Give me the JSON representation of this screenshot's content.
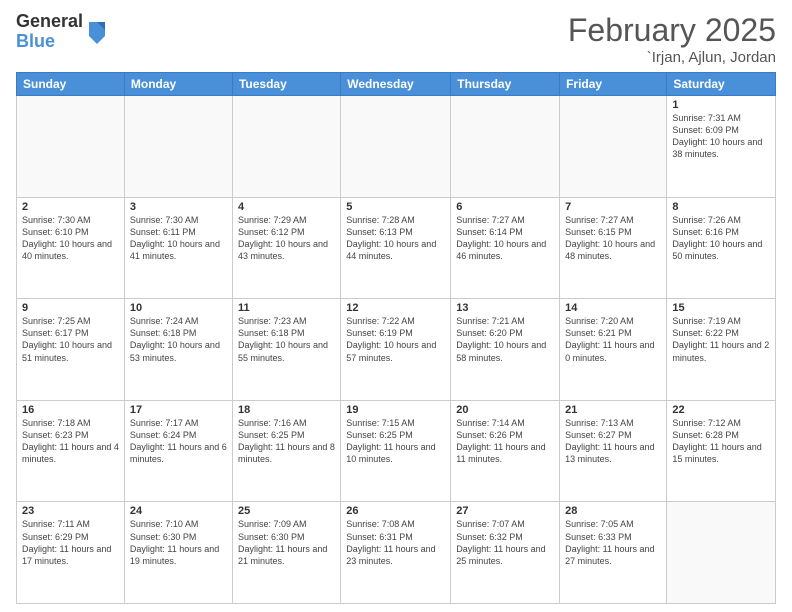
{
  "header": {
    "logo_general": "General",
    "logo_blue": "Blue",
    "month_title": "February 2025",
    "location": "`Irjan, Ajlun, Jordan"
  },
  "weekdays": [
    "Sunday",
    "Monday",
    "Tuesday",
    "Wednesday",
    "Thursday",
    "Friday",
    "Saturday"
  ],
  "weeks": [
    [
      {
        "day": "",
        "info": ""
      },
      {
        "day": "",
        "info": ""
      },
      {
        "day": "",
        "info": ""
      },
      {
        "day": "",
        "info": ""
      },
      {
        "day": "",
        "info": ""
      },
      {
        "day": "",
        "info": ""
      },
      {
        "day": "1",
        "info": "Sunrise: 7:31 AM\nSunset: 6:09 PM\nDaylight: 10 hours\nand 38 minutes."
      }
    ],
    [
      {
        "day": "2",
        "info": "Sunrise: 7:30 AM\nSunset: 6:10 PM\nDaylight: 10 hours\nand 40 minutes."
      },
      {
        "day": "3",
        "info": "Sunrise: 7:30 AM\nSunset: 6:11 PM\nDaylight: 10 hours\nand 41 minutes."
      },
      {
        "day": "4",
        "info": "Sunrise: 7:29 AM\nSunset: 6:12 PM\nDaylight: 10 hours\nand 43 minutes."
      },
      {
        "day": "5",
        "info": "Sunrise: 7:28 AM\nSunset: 6:13 PM\nDaylight: 10 hours\nand 44 minutes."
      },
      {
        "day": "6",
        "info": "Sunrise: 7:27 AM\nSunset: 6:14 PM\nDaylight: 10 hours\nand 46 minutes."
      },
      {
        "day": "7",
        "info": "Sunrise: 7:27 AM\nSunset: 6:15 PM\nDaylight: 10 hours\nand 48 minutes."
      },
      {
        "day": "8",
        "info": "Sunrise: 7:26 AM\nSunset: 6:16 PM\nDaylight: 10 hours\nand 50 minutes."
      }
    ],
    [
      {
        "day": "9",
        "info": "Sunrise: 7:25 AM\nSunset: 6:17 PM\nDaylight: 10 hours\nand 51 minutes."
      },
      {
        "day": "10",
        "info": "Sunrise: 7:24 AM\nSunset: 6:18 PM\nDaylight: 10 hours\nand 53 minutes."
      },
      {
        "day": "11",
        "info": "Sunrise: 7:23 AM\nSunset: 6:18 PM\nDaylight: 10 hours\nand 55 minutes."
      },
      {
        "day": "12",
        "info": "Sunrise: 7:22 AM\nSunset: 6:19 PM\nDaylight: 10 hours\nand 57 minutes."
      },
      {
        "day": "13",
        "info": "Sunrise: 7:21 AM\nSunset: 6:20 PM\nDaylight: 10 hours\nand 58 minutes."
      },
      {
        "day": "14",
        "info": "Sunrise: 7:20 AM\nSunset: 6:21 PM\nDaylight: 11 hours\nand 0 minutes."
      },
      {
        "day": "15",
        "info": "Sunrise: 7:19 AM\nSunset: 6:22 PM\nDaylight: 11 hours\nand 2 minutes."
      }
    ],
    [
      {
        "day": "16",
        "info": "Sunrise: 7:18 AM\nSunset: 6:23 PM\nDaylight: 11 hours\nand 4 minutes."
      },
      {
        "day": "17",
        "info": "Sunrise: 7:17 AM\nSunset: 6:24 PM\nDaylight: 11 hours\nand 6 minutes."
      },
      {
        "day": "18",
        "info": "Sunrise: 7:16 AM\nSunset: 6:25 PM\nDaylight: 11 hours\nand 8 minutes."
      },
      {
        "day": "19",
        "info": "Sunrise: 7:15 AM\nSunset: 6:25 PM\nDaylight: 11 hours\nand 10 minutes."
      },
      {
        "day": "20",
        "info": "Sunrise: 7:14 AM\nSunset: 6:26 PM\nDaylight: 11 hours\nand 11 minutes."
      },
      {
        "day": "21",
        "info": "Sunrise: 7:13 AM\nSunset: 6:27 PM\nDaylight: 11 hours\nand 13 minutes."
      },
      {
        "day": "22",
        "info": "Sunrise: 7:12 AM\nSunset: 6:28 PM\nDaylight: 11 hours\nand 15 minutes."
      }
    ],
    [
      {
        "day": "23",
        "info": "Sunrise: 7:11 AM\nSunset: 6:29 PM\nDaylight: 11 hours\nand 17 minutes."
      },
      {
        "day": "24",
        "info": "Sunrise: 7:10 AM\nSunset: 6:30 PM\nDaylight: 11 hours\nand 19 minutes."
      },
      {
        "day": "25",
        "info": "Sunrise: 7:09 AM\nSunset: 6:30 PM\nDaylight: 11 hours\nand 21 minutes."
      },
      {
        "day": "26",
        "info": "Sunrise: 7:08 AM\nSunset: 6:31 PM\nDaylight: 11 hours\nand 23 minutes."
      },
      {
        "day": "27",
        "info": "Sunrise: 7:07 AM\nSunset: 6:32 PM\nDaylight: 11 hours\nand 25 minutes."
      },
      {
        "day": "28",
        "info": "Sunrise: 7:05 AM\nSunset: 6:33 PM\nDaylight: 11 hours\nand 27 minutes."
      },
      {
        "day": "",
        "info": ""
      }
    ]
  ]
}
